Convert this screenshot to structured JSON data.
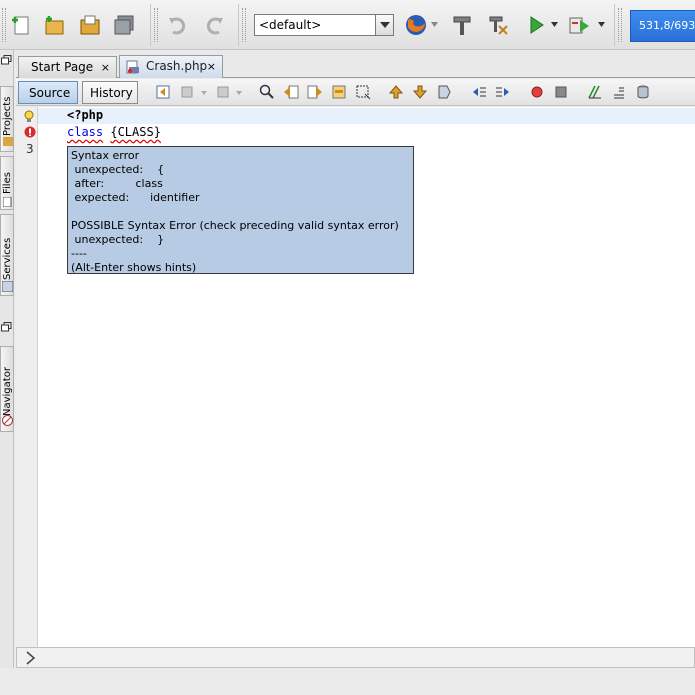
{
  "toolbar": {
    "config_combo": "<default>",
    "memory": "531,8/693"
  },
  "sidebar": {
    "projects": "Projects",
    "files": "Files",
    "services": "Services",
    "navigator": "Navigator"
  },
  "tabs": [
    {
      "label": "Start Page",
      "close": "×"
    },
    {
      "label": "Crash.php",
      "close": "×"
    }
  ],
  "editor_toolbar": {
    "source": "Source",
    "history": "History"
  },
  "editor": {
    "line1": "<?php",
    "line2_kw": "class",
    "line2_rest": "{CLASS}",
    "line_numbers": [
      "3"
    ]
  },
  "tooltip": {
    "lines": [
      "Syntax error",
      " unexpected:    {",
      " after:         class",
      " expected:      identifier",
      "",
      "POSSIBLE Syntax Error (check preceding valid syntax error)",
      " unexpected:    }",
      "----",
      "(Alt-Enter shows hints)"
    ]
  },
  "colors": {
    "tooltip_bg": "#b8cbe4",
    "memory_bar": "#2f7de6",
    "keyword": "#0000e6",
    "error": "#e00000"
  }
}
